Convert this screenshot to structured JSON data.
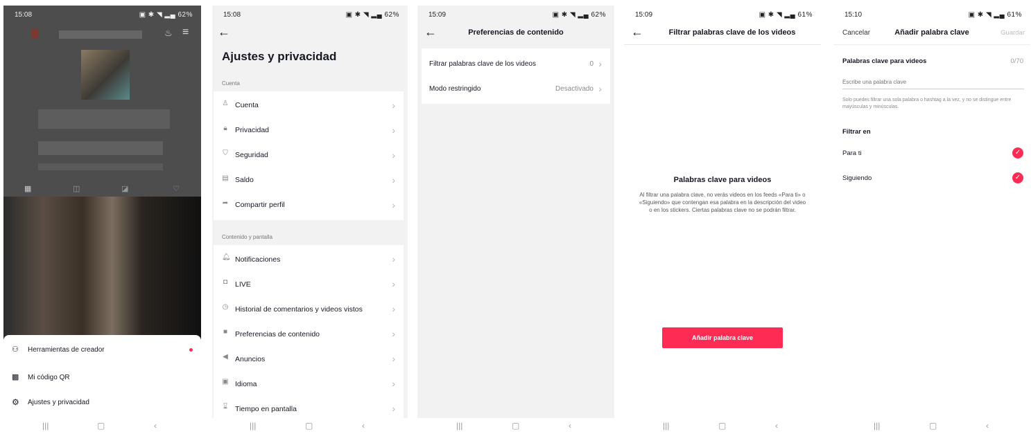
{
  "s1": {
    "time": "15:08",
    "status": "62%",
    "menu": [
      {
        "label": "Herramientas de creador",
        "icon": "creator-tools-icon"
      },
      {
        "label": "Mi código QR",
        "icon": "qr-code-icon"
      },
      {
        "label": "Ajustes y privacidad",
        "icon": "settings-gear-icon"
      }
    ]
  },
  "s2": {
    "time": "15:08",
    "status": "62%",
    "title": "Ajustes y privacidad",
    "section_account": "Cuenta",
    "account_items": [
      {
        "label": "Cuenta",
        "icon": "person-icon"
      },
      {
        "label": "Privacidad",
        "icon": "lock-icon"
      },
      {
        "label": "Seguridad",
        "icon": "shield-icon"
      },
      {
        "label": "Saldo",
        "icon": "wallet-icon"
      },
      {
        "label": "Compartir perfil",
        "icon": "share-icon"
      }
    ],
    "section_content": "Contenido y pantalla",
    "content_items": [
      {
        "label": "Notificaciones",
        "icon": "bell-icon"
      },
      {
        "label": "LIVE",
        "icon": "live-icon"
      },
      {
        "label": "Historial de comentarios y videos vistos",
        "icon": "clock-icon"
      },
      {
        "label": "Preferencias de contenido",
        "icon": "video-icon"
      },
      {
        "label": "Anuncios",
        "icon": "megaphone-icon"
      },
      {
        "label": "Idioma",
        "icon": "language-icon"
      },
      {
        "label": "Tiempo en pantalla",
        "icon": "hourglass-icon"
      }
    ]
  },
  "s3": {
    "time": "15:09",
    "status": "62%",
    "title": "Preferencias de contenido",
    "rows": [
      {
        "label": "Filtrar palabras clave de los videos",
        "value": "0"
      },
      {
        "label": "Modo restringido",
        "value": "Desactivado"
      }
    ]
  },
  "s4": {
    "time": "15:09",
    "status": "61%",
    "title": "Filtrar palabras clave de los videos",
    "heading": "Palabras clave para videos",
    "body": "Al filtrar una palabra clave, no verás videos en los feeds «Para ti» o «Siguiendo» que contengan esa palabra en la descripción del video o en los stickers. Ciertas palabras clave no se podrán filtrar.",
    "button": "Añadir palabra clave"
  },
  "s5": {
    "time": "15:10",
    "status": "61%",
    "cancel": "Cancelar",
    "title": "Añadir palabra clave",
    "save": "Guardar",
    "field_label": "Palabras clave para videos",
    "counter": "0/70",
    "placeholder": "Escribe una palabra clave",
    "hint": "Solo puedes filtrar una sola palabra o hashtag a la vez, y no se distingue entre mayúsculas y minúsculas.",
    "filter_title": "Filtrar en",
    "options": [
      {
        "label": "Para ti",
        "checked": true
      },
      {
        "label": "Siguiendo",
        "checked": true
      }
    ]
  },
  "colors": {
    "accent": "#fe2c55",
    "overlay": "#4a4a4a"
  }
}
